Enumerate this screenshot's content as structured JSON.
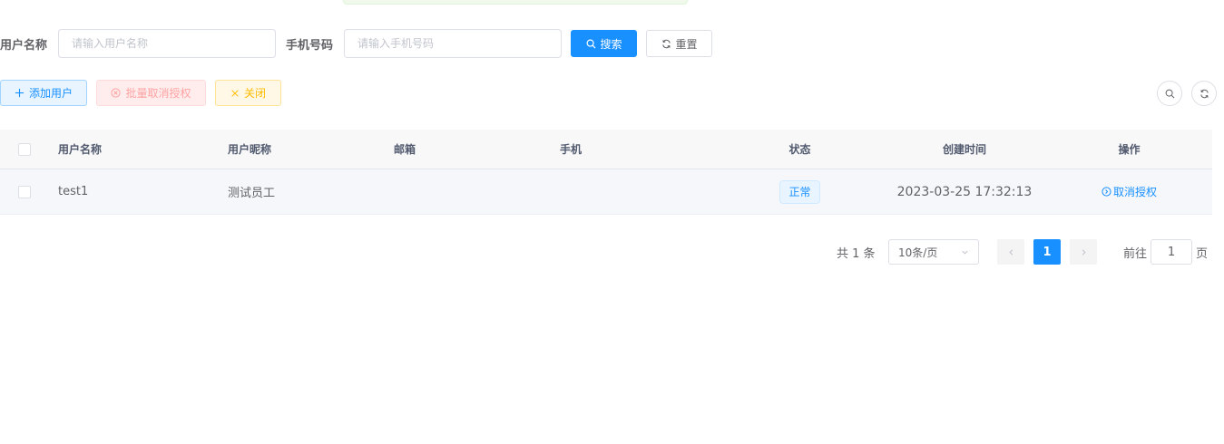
{
  "search": {
    "username_label": "用户名称",
    "username_placeholder": "请输入用户名称",
    "phone_label": "手机号码",
    "phone_placeholder": "请输入手机号码",
    "search_label": "搜索",
    "reset_label": "重置"
  },
  "toolbar": {
    "add_label": "添加用户",
    "batch_cancel_label": "批量取消授权",
    "close_label": "关闭"
  },
  "table": {
    "columns": [
      "用户名称",
      "用户昵称",
      "邮箱",
      "手机",
      "状态",
      "创建时间",
      "操作"
    ],
    "rows": [
      {
        "username": "test1",
        "nickname": "测试员工",
        "email": "",
        "phone": "",
        "status": "正常",
        "created": "2023-03-25 17:32:13",
        "action": "取消授权"
      }
    ]
  },
  "pagination": {
    "total_text": "共 1 条",
    "page_size": "10条/页",
    "current_page": "1",
    "goto_label": "前往",
    "goto_value": "1",
    "page_suffix": "页"
  },
  "colors": {
    "primary": "#1890ff",
    "danger_plain": "#ffa2a2",
    "warning_plain": "#ffba00"
  },
  "icons": {
    "search": "search-icon",
    "reset": "refresh-icon",
    "add": "plus-icon",
    "batch_cancel": "circle-close-icon",
    "close": "close-icon",
    "action": "circle-arrow-icon",
    "prev": "chevron-left-icon",
    "next": "chevron-right-icon",
    "select": "chevron-down-icon"
  }
}
